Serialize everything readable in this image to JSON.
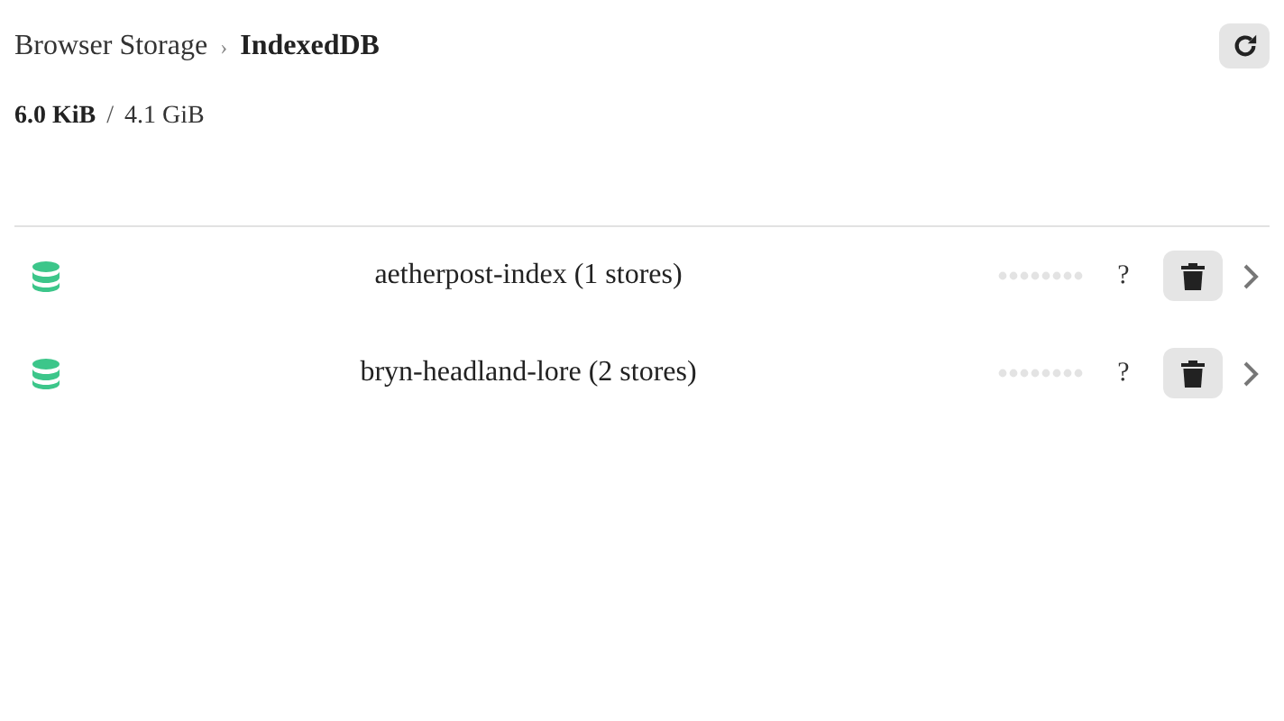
{
  "breadcrumb": [
    {
      "label": "Browser Storage",
      "current": false
    },
    {
      "label": "IndexedDB",
      "current": true
    }
  ],
  "separator": "›",
  "usage": {
    "used": "6.0 KiB",
    "slash": "/",
    "total": "4.1 GiB"
  },
  "databases": [
    {
      "name": "aetherpost-index (1 stores)",
      "size": "?"
    },
    {
      "name": "bryn-headland-lore (2 stores)",
      "size": "?"
    }
  ]
}
